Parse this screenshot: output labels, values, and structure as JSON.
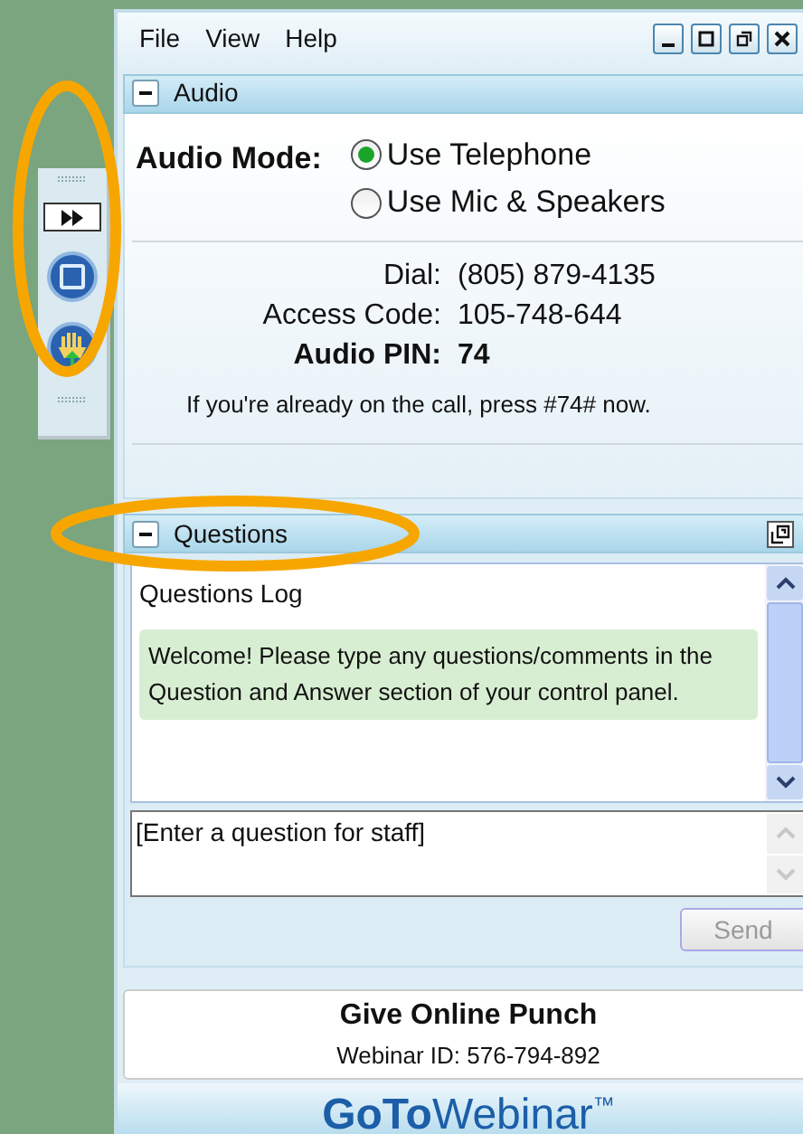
{
  "menu": [
    "File",
    "View",
    "Help"
  ],
  "audio": {
    "title": "Audio",
    "expanded": true,
    "mode_label": "Audio Mode:",
    "modes": [
      {
        "label": "Use Telephone",
        "selected": true
      },
      {
        "label": "Use Mic & Speakers",
        "selected": false
      }
    ],
    "details": [
      {
        "label": "Dial:",
        "value": "(805) 879-4135",
        "emphasis": false
      },
      {
        "label": "Access Code:",
        "value": "105-748-644",
        "emphasis": false
      },
      {
        "label": "Audio PIN:",
        "value": "74",
        "emphasis": true
      }
    ],
    "note": "If you're already on the call, press #74# now."
  },
  "questions": {
    "title": "Questions",
    "expanded": true,
    "log_title": "Questions Log",
    "messages": [
      "Welcome! Please type any questions/comments in the Question and Answer section of your control panel."
    ],
    "input": {
      "placeholder": "[Enter a question for staff]"
    },
    "send": {
      "label": "Send",
      "disabled": true
    }
  },
  "webinar": {
    "name": "Give Online Punch",
    "id": "Webinar ID: 576-794-892"
  },
  "logo": {
    "bold": "GoTo",
    "light": "Webinar",
    "mark": "™"
  }
}
